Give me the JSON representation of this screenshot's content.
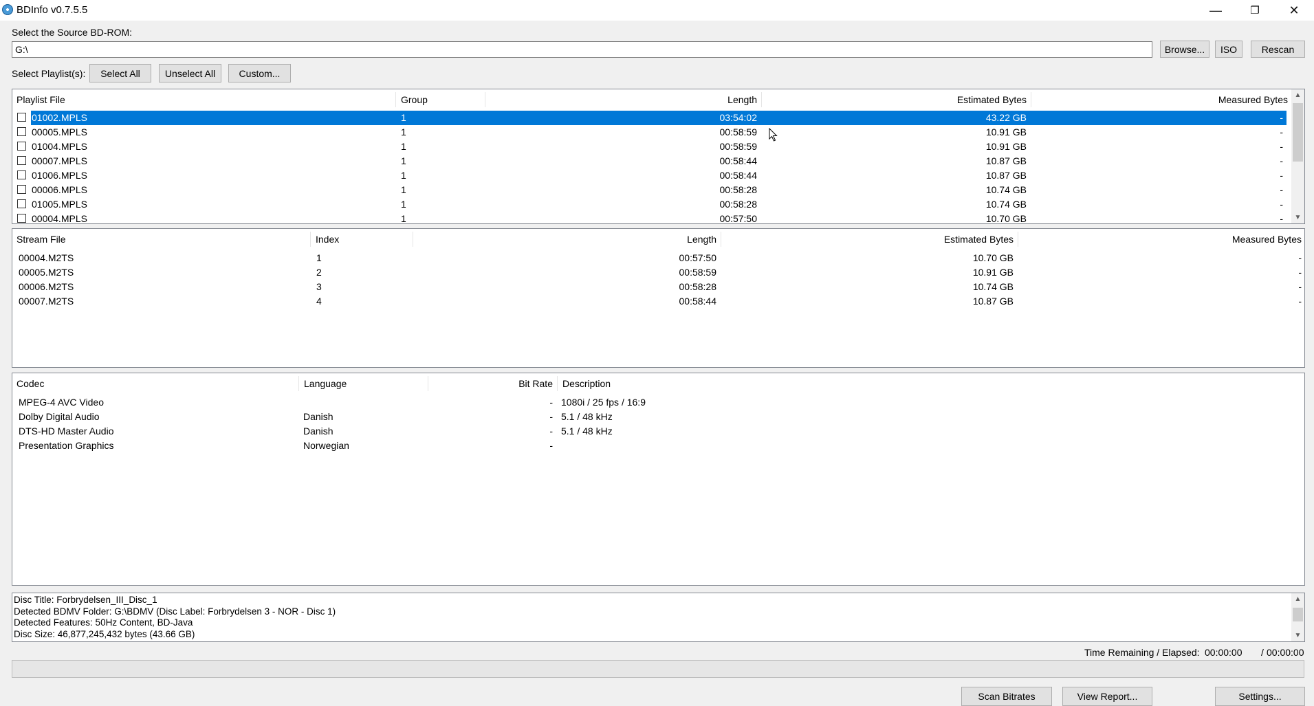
{
  "window": {
    "title": "BDInfo v0.7.5.5",
    "minimize_glyph": "—",
    "maximize_glyph": "❐",
    "close_glyph": "✕"
  },
  "source": {
    "label": "Select the Source BD-ROM:",
    "value": "G:\\",
    "browse_label": "Browse...",
    "iso_label": "ISO",
    "rescan_label": "Rescan"
  },
  "playlist_select": {
    "label": "Select Playlist(s):",
    "select_all_label": "Select All",
    "unselect_all_label": "Unselect All",
    "custom_label": "Custom..."
  },
  "playlists": {
    "columns": [
      "Playlist File",
      "Group",
      "Length",
      "Estimated Bytes",
      "Measured Bytes"
    ],
    "rows": [
      {
        "file": "01002.MPLS",
        "group": "1",
        "length": "03:54:02",
        "estimated": "43.22 GB",
        "measured": "-",
        "selected": true
      },
      {
        "file": "00005.MPLS",
        "group": "1",
        "length": "00:58:59",
        "estimated": "10.91 GB",
        "measured": "-",
        "selected": false
      },
      {
        "file": "01004.MPLS",
        "group": "1",
        "length": "00:58:59",
        "estimated": "10.91 GB",
        "measured": "-",
        "selected": false
      },
      {
        "file": "00007.MPLS",
        "group": "1",
        "length": "00:58:44",
        "estimated": "10.87 GB",
        "measured": "-",
        "selected": false
      },
      {
        "file": "01006.MPLS",
        "group": "1",
        "length": "00:58:44",
        "estimated": "10.87 GB",
        "measured": "-",
        "selected": false
      },
      {
        "file": "00006.MPLS",
        "group": "1",
        "length": "00:58:28",
        "estimated": "10.74 GB",
        "measured": "-",
        "selected": false
      },
      {
        "file": "01005.MPLS",
        "group": "1",
        "length": "00:58:28",
        "estimated": "10.74 GB",
        "measured": "-",
        "selected": false
      },
      {
        "file": "00004.MPLS",
        "group": "1",
        "length": "00:57:50",
        "estimated": "10.70 GB",
        "measured": "-",
        "selected": false
      }
    ]
  },
  "streams": {
    "columns": [
      "Stream File",
      "Index",
      "Length",
      "Estimated Bytes",
      "Measured Bytes"
    ],
    "rows": [
      {
        "file": "00004.M2TS",
        "index": "1",
        "length": "00:57:50",
        "estimated": "10.70 GB",
        "measured": "-"
      },
      {
        "file": "00005.M2TS",
        "index": "2",
        "length": "00:58:59",
        "estimated": "10.91 GB",
        "measured": "-"
      },
      {
        "file": "00006.M2TS",
        "index": "3",
        "length": "00:58:28",
        "estimated": "10.74 GB",
        "measured": "-"
      },
      {
        "file": "00007.M2TS",
        "index": "4",
        "length": "00:58:44",
        "estimated": "10.87 GB",
        "measured": "-"
      }
    ]
  },
  "codecs": {
    "columns": [
      "Codec",
      "Language",
      "Bit Rate",
      "Description"
    ],
    "rows": [
      {
        "codec": "MPEG-4 AVC Video",
        "language": "",
        "bitrate": "-",
        "description": "1080i / 25 fps / 16:9"
      },
      {
        "codec": "Dolby Digital Audio",
        "language": "Danish",
        "bitrate": "-",
        "description": "5.1 / 48 kHz"
      },
      {
        "codec": "DTS-HD Master Audio",
        "language": "Danish",
        "bitrate": "-",
        "description": "5.1 / 48 kHz"
      },
      {
        "codec": "Presentation Graphics",
        "language": "Norwegian",
        "bitrate": "-",
        "description": ""
      }
    ]
  },
  "log": {
    "lines": [
      "Disc Title: Forbrydelsen_III_Disc_1",
      "Detected BDMV Folder: G:\\BDMV (Disc Label: Forbrydelsen 3 - NOR - Disc 1)",
      "Detected Features: 50Hz Content, BD-Java",
      "Disc Size: 46,877,245,432 bytes (43.66 GB)"
    ]
  },
  "time": {
    "label": "Time Remaining / Elapsed:",
    "remaining": "00:00:00",
    "separator": "/",
    "elapsed": "00:00:00"
  },
  "progress": {
    "fraction": 0
  },
  "bottom": {
    "scan_label": "Scan Bitrates",
    "report_label": "View Report...",
    "settings_label": "Settings..."
  },
  "icons": {
    "app": "bdinfo-disc-icon",
    "scroll_up": "▲",
    "scroll_down": "▼"
  },
  "colors": {
    "selection": "#0078d7",
    "window": "#f0f0f0",
    "panel": "#ffffff"
  }
}
